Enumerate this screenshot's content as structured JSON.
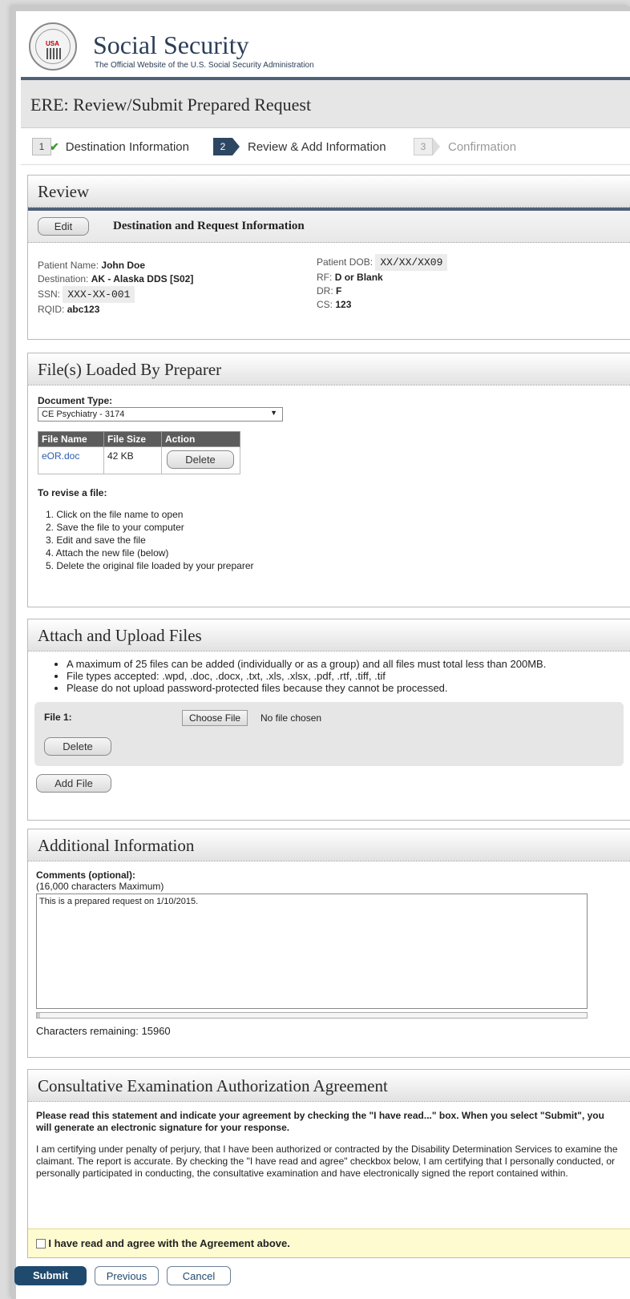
{
  "header": {
    "brand_title": "Social Security",
    "brand_subtitle": "The Official Website of the U.S. Social Security Administration",
    "seal_text": "USA"
  },
  "page_title": "ERE: Review/Submit Prepared Request",
  "steps": [
    {
      "num": "1",
      "label": "Destination Information",
      "state": "done"
    },
    {
      "num": "2",
      "label": "Review & Add Information",
      "state": "active"
    },
    {
      "num": "3",
      "label": "Confirmation",
      "state": "pending"
    }
  ],
  "review": {
    "heading": "Review",
    "edit_label": "Edit",
    "subheading": "Destination and Request Information",
    "patient_name_label": "Patient Name:",
    "patient_name": "John Doe",
    "destination_label": "Destination:",
    "destination": "AK - Alaska DDS [S02]",
    "ssn_label": "SSN:",
    "ssn": "XXX-XX-001",
    "rqid_label": "RQID:",
    "rqid": "abc123",
    "dob_label": "Patient DOB:",
    "dob": "XX/XX/XX09",
    "rf_label": "RF:",
    "rf": "D or Blank",
    "dr_label": "DR:",
    "dr": "F",
    "cs_label": "CS:",
    "cs": "123"
  },
  "files_loaded": {
    "heading": "File(s) Loaded By Preparer",
    "doc_type_label": "Document Type:",
    "doc_type_value": "CE Psychiatry - 3174",
    "table_headers": [
      "File Name",
      "File Size",
      "Action"
    ],
    "file_name": "eOR.doc",
    "file_size": "42 KB",
    "delete_label": "Delete",
    "revise_title": "To revise a file:",
    "revise_steps": [
      "1.  Click on the file name to open",
      "2.  Save the file to your computer",
      "3.  Edit and save the file",
      "4.  Attach the new file (below)",
      "5.  Delete the original file loaded by your preparer"
    ]
  },
  "attach": {
    "heading": "Attach and Upload Files",
    "bullets": [
      "A maximum of 25 files can be added (individually or as a group) and all files must total less than 200MB.",
      "File types accepted: .wpd, .doc, .docx, .txt, .xls, .xlsx, .pdf, .rtf, .tiff, .tif",
      "Please do not upload password-protected files because they cannot be processed."
    ],
    "file_label": "File 1:",
    "choose_label": "Choose File",
    "no_file": "No file chosen",
    "delete_label": "Delete",
    "add_label": "Add File"
  },
  "additional": {
    "heading": "Additional Information",
    "comments_label": "Comments (optional):",
    "max_note": "(16,000 characters Maximum)",
    "comment_text": "This is a prepared request on 1/10/2015.",
    "remaining_label": "Characters remaining:",
    "remaining_value": "15960"
  },
  "agreement": {
    "heading": "Consultative Examination Authorization Agreement",
    "instruction": "Please read this statement and indicate your agreement by checking the \"I have read...\" box. When you select \"Submit\", you will generate an electronic signature for your response.",
    "body": "I am certifying under penalty of perjury, that I have been authorized or contracted by the Disability Determination Services to examine the claimant. The report is accurate. By checking the \"I have read and agree\" checkbox below, I am certifying that I personally conducted, or personally participated in conducting, the consultative examination and have electronically signed the report contained within.",
    "checkbox_label": "I have read and agree with the Agreement above."
  },
  "footer": {
    "submit": "Submit",
    "previous": "Previous",
    "cancel": "Cancel"
  },
  "colors": {
    "navy": "#2d4763",
    "link": "#2a5db0",
    "agreement_bg": "#fffbd0"
  }
}
